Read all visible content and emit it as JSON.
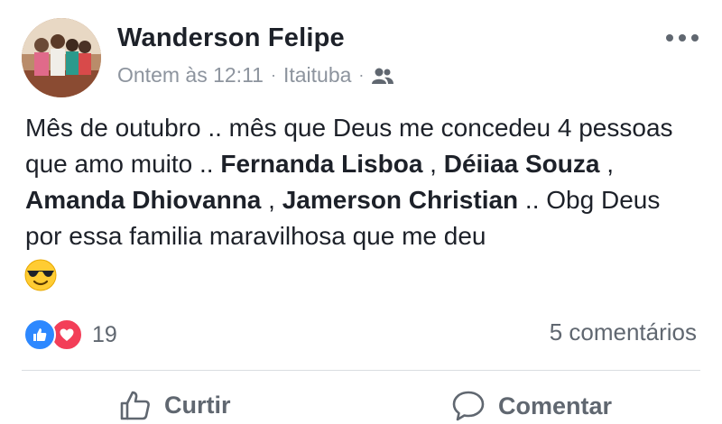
{
  "post": {
    "author": "Wanderson Felipe",
    "timestamp": "Ontem às 12:11",
    "separator": "·",
    "location": "Itaituba",
    "audience_icon": "friends-icon",
    "text_1": "Mês de outubro .. mês que Deus me concedeu 4 pessoas que amo muito .. ",
    "tag_1": "Fernanda Lisboa",
    "sep_1": " , ",
    "tag_2": "Déiiaa Souza",
    "sep_2": " , ",
    "tag_3": "Amanda Dhiovanna",
    "sep_3": " , ",
    "tag_4": "Jamerson Christian",
    "text_2": " .. Obg Deus por essa familia maravilhosa que me deu",
    "emoji": "smiling-face-with-sunglasses"
  },
  "stats": {
    "reactions_count": "19",
    "comments": "5 comentários"
  },
  "actions": {
    "like_label": "Curtir",
    "comment_label": "Comentar"
  },
  "colors": {
    "like_blue": "#2d88ff",
    "love_red": "#f33e58",
    "meta_gray": "#8d949e"
  }
}
